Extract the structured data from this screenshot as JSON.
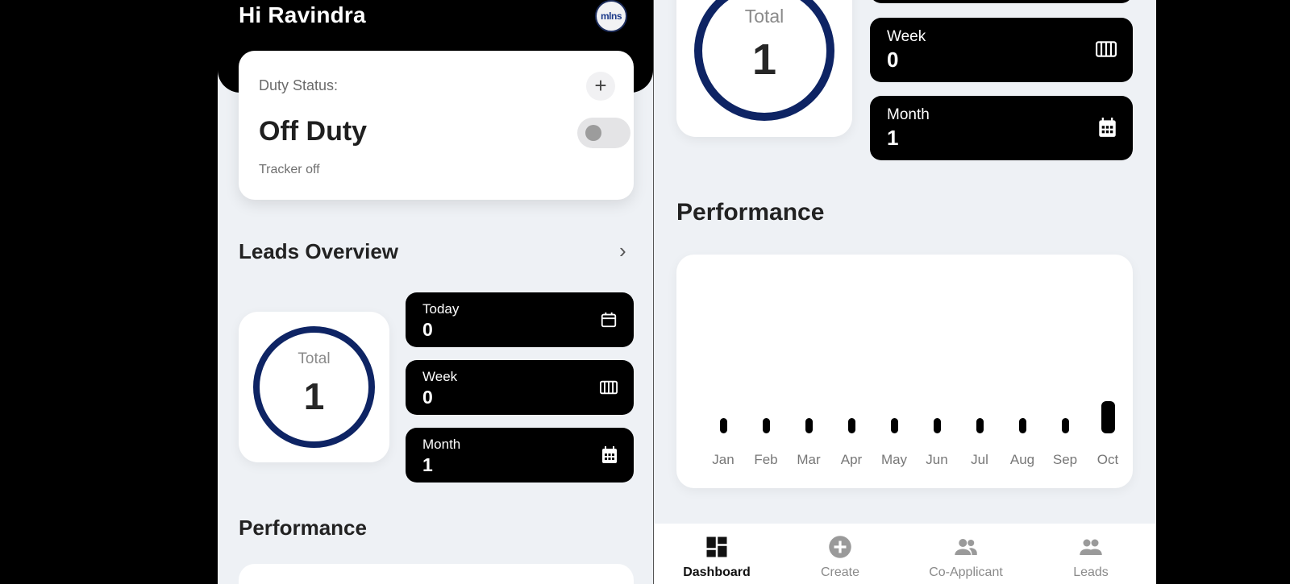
{
  "left": {
    "greeting": "Hi Ravindra",
    "logo_text": "mlns",
    "duty": {
      "label": "Duty Status:",
      "add_symbol": "+",
      "value": "Off Duty",
      "tracker": "Tracker off",
      "toggle_on": false
    },
    "leads_overview": {
      "title": "Leads Overview",
      "chevron": "›",
      "total_label": "Total",
      "total_value": "1",
      "stats": [
        {
          "label": "Today",
          "value": "0",
          "icon": "calendar-icon"
        },
        {
          "label": "Week",
          "value": "0",
          "icon": "week-icon"
        },
        {
          "label": "Month",
          "value": "1",
          "icon": "calendar-month-icon"
        }
      ]
    },
    "performance_title": "Performance"
  },
  "right": {
    "total_label": "Total",
    "total_value": "1",
    "stats": [
      {
        "label": "Week",
        "value": "0",
        "icon": "week-icon"
      },
      {
        "label": "Month",
        "value": "1",
        "icon": "calendar-month-icon"
      }
    ],
    "performance_title": "Performance",
    "chart_data": {
      "type": "bar",
      "categories": [
        "Jan",
        "Feb",
        "Mar",
        "Apr",
        "May",
        "Jun",
        "Jul",
        "Aug",
        "Sep",
        "Oct"
      ],
      "values": [
        0,
        0,
        0,
        0,
        0,
        0,
        0,
        0,
        0,
        1
      ],
      "title": "",
      "xlabel": "",
      "ylabel": "",
      "ylim": [
        0,
        1
      ],
      "grid": false
    },
    "nav": [
      {
        "label": "Dashboard",
        "icon": "dashboard-icon",
        "active": true
      },
      {
        "label": "Create",
        "icon": "add-circle-icon",
        "active": false
      },
      {
        "label": "Co-Applicant",
        "icon": "people-icon",
        "active": false
      },
      {
        "label": "Leads",
        "icon": "people-icon",
        "active": false
      }
    ]
  },
  "colors": {
    "ring": "#0e2464",
    "card_dark": "#000000",
    "background": "#eef1f5"
  }
}
